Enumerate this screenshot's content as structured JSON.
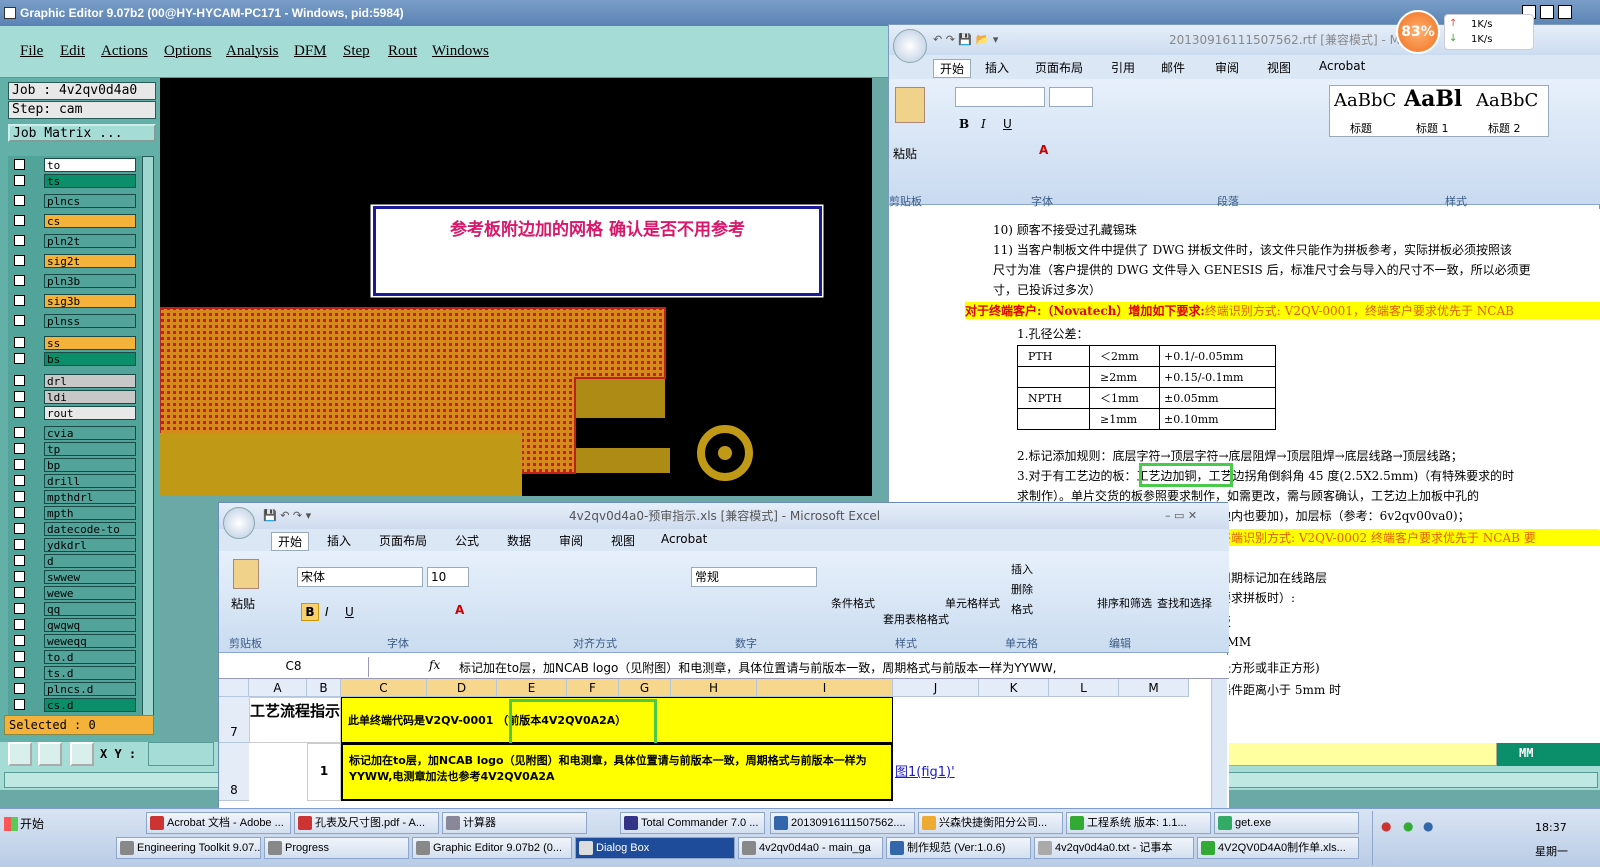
{
  "ge": {
    "title": "Graphic Editor 9.07b2 (00@HY-HYCAM-PC171 - Windows, pid:5984)",
    "menu": [
      "File",
      "Edit",
      "Actions",
      "Options",
      "Analysis",
      "DFM",
      "Step",
      "Rout",
      "Windows"
    ],
    "job": "Job : 4v2qv0d4a0",
    "step": "Step: cam",
    "job_matrix": "Job Matrix ...",
    "layers": [
      "to",
      "ts",
      "plncs",
      "cs",
      "pln2t",
      "sig2t",
      "pln3b",
      "sig3b",
      "plnss",
      "ss",
      "bs",
      "drl",
      "ldi",
      "rout",
      "cvia",
      "tp",
      "bp",
      "drill",
      "mpthdrl",
      "mpth",
      "datecode-to",
      "ydkdrl",
      "d",
      "swwew",
      "wewe",
      "qq",
      "qwqwq",
      "weweqq",
      "to.d",
      "ts.d",
      "plncs.d",
      "cs.d"
    ],
    "selected": "Selected : 0",
    "xy_label": "X Y :",
    "units": "MM",
    "note": "参考板附边加的网格  确认是否不用参考"
  },
  "word": {
    "title": "20130916111507562.rtf [兼容模式] - Mi",
    "tabs": [
      "开始",
      "插入",
      "页面布局",
      "引用",
      "邮件",
      "审阅",
      "视图",
      "Acrobat"
    ],
    "groups": [
      "剪贴板",
      "字体",
      "段落",
      "样式"
    ],
    "paste": "粘贴",
    "styles": [
      {
        "sample": "AaBbC",
        "name": "标题"
      },
      {
        "sample": "AaBl",
        "name": "标题 1"
      },
      {
        "sample": "AaBbC",
        "name": "标题 2"
      }
    ],
    "lines": [
      "10) 顾客不接受过孔藏锡珠",
      "11) 当客户制板文件中提供了 DWG 拼板文件时，该文件只能作为拼板参考，实际拼板必须按照该",
      "尺寸为准（客户提供的 DWG 文件导入 GENESIS 后，标准尺寸会与导入的尺寸不一致，所以必须更",
      "寸，已投诉过多次）",
      "1.孔径公差：",
      "2.标记添加规则：底层字符→顶层字符→底层阻焊→顶层阻焊→底层线路→顶层线路；",
      "3.对于有工艺边的板：工艺边加铜，工艺边拐角倒斜角 45 度(2.5X2.5mm)（有特殊要求的时",
      "求制作）。单片交货的板参照要求制作，如需更改，需与顾客确认，工艺边上加板中孔的",
      "边内也要加)，加层标（参考：6v2qv00va0)；",
      "周期标记加在线路层",
      "要求拼板时）:",
      "板",
      "0MM",
      "长方形或非正方形)",
      "器件距离小于 5mm 时"
    ],
    "highlight1_red": "对于终端客户:（Novatech）增加如下要求:",
    "highlight1_rest": "终端识别方式: V2QV-0001，终端客户要求优先于 NCAB",
    "highlight2": "终端识别方式: V2QV-0002 终端客户要求优先于 NCAB 要",
    "table": [
      [
        "PTH",
        "＜2mm",
        "+0.1/-0.05mm"
      ],
      [
        "",
        "≥2mm",
        "+0.15/-0.1mm"
      ],
      [
        "NPTH",
        "＜1mm",
        "±0.05mm"
      ],
      [
        "",
        "≥1mm",
        "±0.10mm"
      ]
    ]
  },
  "excel": {
    "title": "4v2qv0d4a0-预审指示.xls [兼容模式] - Microsoft Excel",
    "tabs": [
      "开始",
      "插入",
      "页面布局",
      "公式",
      "数据",
      "审阅",
      "视图",
      "Acrobat"
    ],
    "font": "宋体",
    "size": "10",
    "number_format": "常规",
    "groups": [
      "剪贴板",
      "字体",
      "对齐方式",
      "数字",
      "样式",
      "单元格",
      "编辑"
    ],
    "cond_fmt": "条件格式",
    "table_fmt": "套用表格格式",
    "cell_style": "单元格样式",
    "insert": "插入",
    "delete": "删除",
    "format": "格式",
    "sort": "排序和筛选",
    "find": "查找和选择",
    "namebox": "C8",
    "formula": "标记加在to层，加NCAB logo（见附图）和电测章，具体位置请与前版本一致，周期格式与前版本一样为YYWW,",
    "cols": [
      "A",
      "B",
      "C",
      "D",
      "E",
      "F",
      "G",
      "H",
      "I",
      "J",
      "K",
      "L",
      "M"
    ],
    "row7_label": "工艺流程指示",
    "row7_text": "此单终端代码是V2QV-0001",
    "row7_prev": "（前版本4V2QV0A2A）",
    "row8_num": "1",
    "row8_text": "标记加在to层，加NCAB logo（见附图）和电测章，具体位置请与前版本一致，周期格式与前版本一样为YYWW,电测章加法也参考4V2QV0A2A",
    "row8_link": "图1(fig1)'",
    "rows": [
      "7",
      "8"
    ]
  },
  "tray": {
    "cpu": "83%",
    "up": "1K/s",
    "down": "1K/s",
    "time": "18:37",
    "day": "星期一"
  },
  "taskbar": {
    "start": "开始",
    "row1": [
      "Acrobat 文档 - Adobe ...",
      "孔表及尺寸图.pdf - A...",
      "计算器",
      "Total Commander 7.0 ...",
      "20130916111507562....",
      "兴森快捷衡阳分公司...",
      "工程系统  版本: 1.1...",
      "get.exe"
    ],
    "row2": [
      "Engineering Toolkit 9.07...",
      "Progress",
      "Graphic Editor 9.07b2 (0...",
      "Dialog Box",
      "4v2qv0d4a0 - main_ga",
      "制作规范 (Ver:1.0.6)",
      "4v2qv0d4a0.txt - 记事本",
      "4V2QV0D4A0制作单.xls..."
    ]
  }
}
